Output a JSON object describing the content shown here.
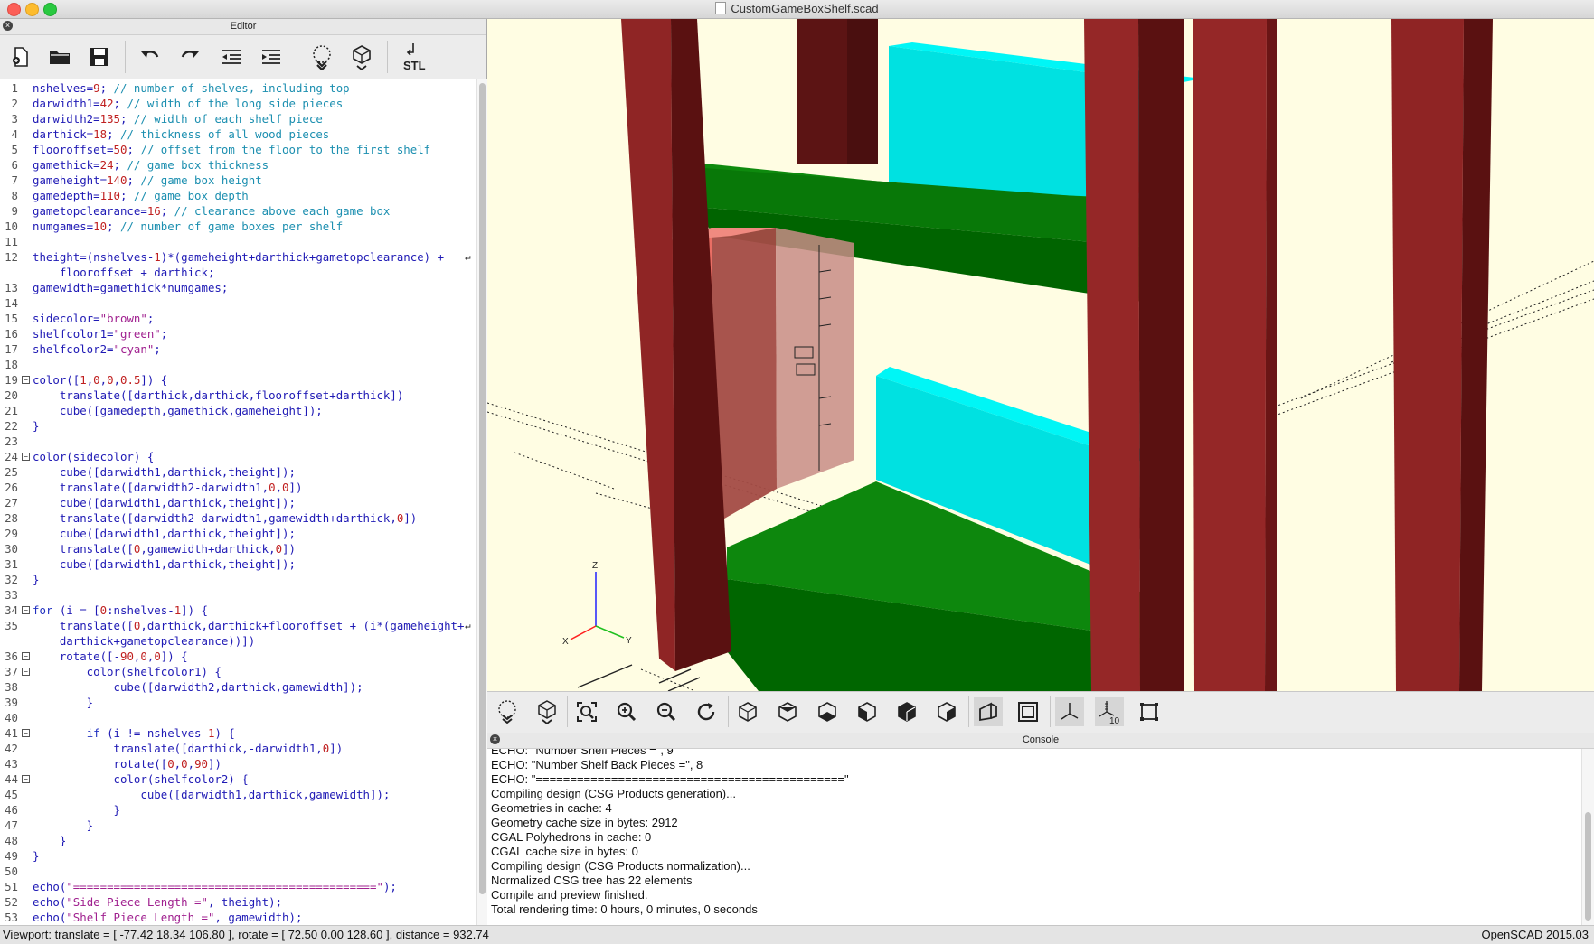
{
  "window": {
    "title": "CustomGameBoxShelf.scad"
  },
  "editor": {
    "title": "Editor",
    "toolbar": [
      {
        "name": "new-file-icon"
      },
      {
        "name": "open-folder-icon"
      },
      {
        "name": "save-icon"
      },
      {
        "name": "undo-icon"
      },
      {
        "name": "redo-icon"
      },
      {
        "name": "unindent-icon"
      },
      {
        "name": "indent-icon"
      },
      {
        "name": "preview-icon"
      },
      {
        "name": "render-icon"
      },
      {
        "name": "export-stl-icon",
        "label": "STL"
      }
    ],
    "lines": [
      {
        "n": "1",
        "t": "nshelves=9; // number of shelves, including top"
      },
      {
        "n": "2",
        "t": "darwidth1=42; // width of the long side pieces"
      },
      {
        "n": "3",
        "t": "darwidth2=135; // width of each shelf piece"
      },
      {
        "n": "4",
        "t": "darthick=18; // thickness of all wood pieces"
      },
      {
        "n": "5",
        "t": "flooroffset=50; // offset from the floor to the first shelf"
      },
      {
        "n": "6",
        "t": "gamethick=24; // game box thickness"
      },
      {
        "n": "7",
        "t": "gameheight=140; // game box height"
      },
      {
        "n": "8",
        "t": "gamedepth=110; // game box depth"
      },
      {
        "n": "9",
        "t": "gametopclearance=16; // clearance above each game box"
      },
      {
        "n": "10",
        "t": "numgames=10; // number of game boxes per shelf"
      },
      {
        "n": "11",
        "t": ""
      },
      {
        "n": "12",
        "t": "theight=(nshelves-1)*(gameheight+darthick+gametopclearance) +",
        "wrap": true
      },
      {
        "n": "",
        "t": "    flooroffset + darthick;"
      },
      {
        "n": "13",
        "t": "gamewidth=gamethick*numgames;"
      },
      {
        "n": "14",
        "t": ""
      },
      {
        "n": "15",
        "t": "sidecolor=\"brown\";"
      },
      {
        "n": "16",
        "t": "shelfcolor1=\"green\";"
      },
      {
        "n": "17",
        "t": "shelfcolor2=\"cyan\";"
      },
      {
        "n": "18",
        "t": ""
      },
      {
        "n": "19",
        "t": "color([1,0,0,0.5]) {",
        "fold": true
      },
      {
        "n": "20",
        "t": "    translate([darthick,darthick,flooroffset+darthick])"
      },
      {
        "n": "21",
        "t": "    cube([gamedepth,gamethick,gameheight]);"
      },
      {
        "n": "22",
        "t": "}"
      },
      {
        "n": "23",
        "t": ""
      },
      {
        "n": "24",
        "t": "color(sidecolor) {",
        "fold": true
      },
      {
        "n": "25",
        "t": "    cube([darwidth1,darthick,theight]);"
      },
      {
        "n": "26",
        "t": "    translate([darwidth2-darwidth1,0,0])"
      },
      {
        "n": "27",
        "t": "    cube([darwidth1,darthick,theight]);"
      },
      {
        "n": "28",
        "t": "    translate([darwidth2-darwidth1,gamewidth+darthick,0])"
      },
      {
        "n": "29",
        "t": "    cube([darwidth1,darthick,theight]);"
      },
      {
        "n": "30",
        "t": "    translate([0,gamewidth+darthick,0])"
      },
      {
        "n": "31",
        "t": "    cube([darwidth1,darthick,theight]);"
      },
      {
        "n": "32",
        "t": "}"
      },
      {
        "n": "33",
        "t": ""
      },
      {
        "n": "34",
        "t": "for (i = [0:nshelves-1]) {",
        "fold": true
      },
      {
        "n": "35",
        "t": "    translate([0,darthick,darthick+flooroffset + (i*(gameheight+",
        "wrap": true
      },
      {
        "n": "",
        "t": "    darthick+gametopclearance))])"
      },
      {
        "n": "36",
        "t": "    rotate([-90,0,0]) {",
        "fold": true
      },
      {
        "n": "37",
        "t": "        color(shelfcolor1) {",
        "fold": true
      },
      {
        "n": "38",
        "t": "            cube([darwidth2,darthick,gamewidth]);"
      },
      {
        "n": "39",
        "t": "        }"
      },
      {
        "n": "40",
        "t": ""
      },
      {
        "n": "41",
        "t": "        if (i != nshelves-1) {",
        "fold": true
      },
      {
        "n": "42",
        "t": "            translate([darthick,-darwidth1,0])"
      },
      {
        "n": "43",
        "t": "            rotate([0,0,90])"
      },
      {
        "n": "44",
        "t": "            color(shelfcolor2) {",
        "fold": true
      },
      {
        "n": "45",
        "t": "                cube([darwidth1,darthick,gamewidth]);"
      },
      {
        "n": "46",
        "t": "            }"
      },
      {
        "n": "47",
        "t": "        }"
      },
      {
        "n": "48",
        "t": "    }"
      },
      {
        "n": "49",
        "t": "}"
      },
      {
        "n": "50",
        "t": ""
      },
      {
        "n": "51",
        "t": "echo(\"=============================================\");"
      },
      {
        "n": "52",
        "t": "echo(\"Side Piece Length =\", theight);"
      },
      {
        "n": "53",
        "t": "echo(\"Shelf Piece Length =\", gamewidth);"
      }
    ]
  },
  "viewport": {
    "axis_labels": {
      "x": "X",
      "y": "Y",
      "z": "Z"
    },
    "colors": {
      "background": "#fffde3",
      "brown": "#8b2323",
      "green": "#008000",
      "cyan": "#00e5e5",
      "ghost": "#e86a60"
    },
    "toolbar": [
      {
        "name": "preview-icon"
      },
      {
        "name": "render-icon"
      },
      {
        "name": "view-all-icon"
      },
      {
        "name": "zoom-in-icon"
      },
      {
        "name": "zoom-out-icon"
      },
      {
        "name": "reset-view-icon"
      },
      {
        "name": "view-right-icon"
      },
      {
        "name": "view-top-icon"
      },
      {
        "name": "view-bottom-icon"
      },
      {
        "name": "view-left-icon"
      },
      {
        "name": "view-front-icon"
      },
      {
        "name": "view-back-icon"
      },
      {
        "name": "perspective-icon"
      },
      {
        "name": "orthogonal-icon"
      },
      {
        "name": "show-axes-icon"
      },
      {
        "name": "show-scale-markers-icon",
        "label": "10"
      },
      {
        "name": "show-edges-icon"
      }
    ]
  },
  "console": {
    "title": "Console",
    "lines": [
      "ECHO: \"Number Shelf Pieces =\", 9",
      "ECHO: \"Number Shelf Back Pieces =\", 8",
      "ECHO: \"=============================================\"",
      "Compiling design (CSG Products generation)...",
      "Geometries in cache: 4",
      "Geometry cache size in bytes: 2912",
      "CGAL Polyhedrons in cache: 0",
      "CGAL cache size in bytes: 0",
      "Compiling design (CSG Products normalization)...",
      "Normalized CSG tree has 22 elements",
      "Compile and preview finished.",
      "Total rendering time: 0 hours, 0 minutes, 0 seconds"
    ]
  },
  "status": {
    "viewport": "Viewport: translate = [ -77.42 18.34 106.80 ], rotate = [ 72.50 0.00 128.60 ], distance = 932.74",
    "app": "OpenSCAD 2015.03"
  }
}
